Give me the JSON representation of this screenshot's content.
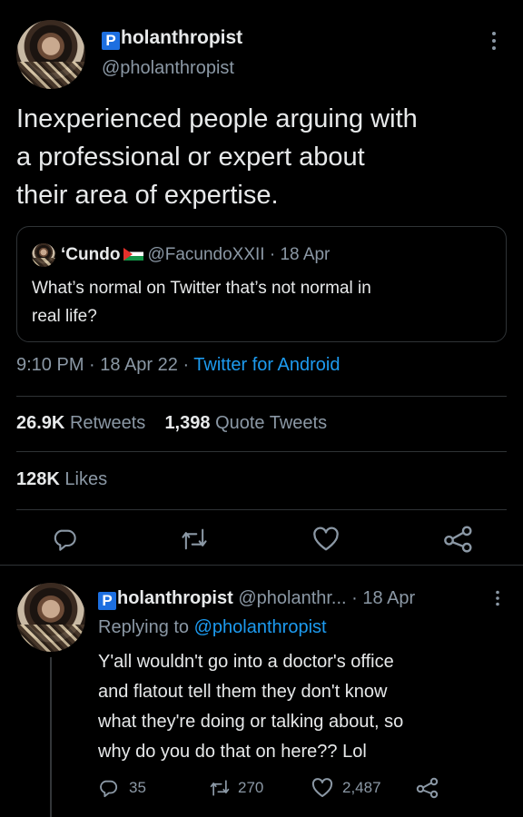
{
  "main_tweet": {
    "display_name": "holanthropist",
    "badge_letter": "P",
    "handle": "@pholanthropist",
    "text_lines": [
      "Inexperienced people arguing with",
      "a professional or expert about",
      "their area of expertise."
    ],
    "quoted": {
      "display_name": "‘Cundo",
      "handle_date": "@FacundoXXII · 18 Apr",
      "text_lines": [
        "What’s normal on Twitter that’s not normal in",
        "real life?"
      ]
    },
    "time": "9:10 PM · 18 Apr 22 · ",
    "source": "Twitter for Android",
    "retweets_count": "26.9K",
    "retweets_label": "Retweets",
    "quotes_count": "1,398",
    "quotes_label": "Quote Tweets",
    "likes_count": "128K",
    "likes_label": "Likes"
  },
  "reply": {
    "badge_letter": "P",
    "display_name": "holanthropist",
    "handle_date": "@pholanthr... · 18 Apr",
    "replying_label": "Replying to ",
    "replying_handle": "@pholanthropist",
    "text_lines": [
      "Y'all wouldn't go into a doctor's office",
      "and flatout tell them they don't know",
      "what they're doing or talking about, so",
      "why do you do that on here?? Lol"
    ],
    "reply_count": "35",
    "retweet_count": "270",
    "like_count": "2,487"
  },
  "icons": [
    "more-icon",
    "reply-icon",
    "retweet-icon",
    "like-icon",
    "share-icon"
  ],
  "colors": {
    "background": "#000000",
    "text": "#e7e9ea",
    "muted": "#8b98a5",
    "accent": "#1d9bf0",
    "divider": "#2f3336"
  }
}
